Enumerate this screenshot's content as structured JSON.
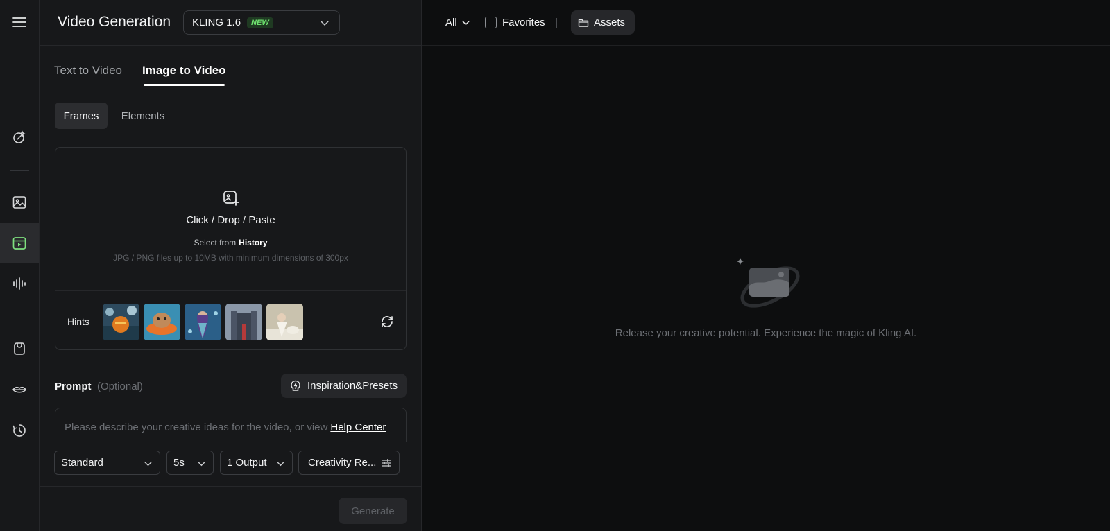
{
  "header": {
    "title": "Video Generation",
    "model": "KLING 1.6",
    "model_badge": "NEW"
  },
  "tabs": [
    {
      "label": "Text to Video"
    },
    {
      "label": "Image to Video",
      "active": true
    }
  ],
  "subtabs": [
    {
      "label": "Frames",
      "active": true
    },
    {
      "label": "Elements"
    }
  ],
  "upload": {
    "title": "Click / Drop / Paste",
    "select_from": "Select from",
    "history": "History",
    "note": "JPG / PNG files up to 10MB with minimum dimensions of 300px"
  },
  "hints": {
    "label": "Hints",
    "thumbnails": [
      "pumpkin-house-thumb",
      "capybara-float-thumb",
      "mermaid-thumb",
      "castle-thumb",
      "snow-girl-thumb"
    ]
  },
  "prompt": {
    "label": "Prompt",
    "optional": "(Optional)",
    "placeholder": "Please describe your creative ideas for the video, or view",
    "help_link": "Help Center",
    "inspiration_button": "Inspiration&Presets"
  },
  "settings": {
    "mode": "Standard",
    "duration": "5s",
    "outputs": "1 Output",
    "creativity": "Creativity Re..."
  },
  "generate_button": "Generate",
  "topbar": {
    "filter": "All",
    "favorites": "Favorites",
    "assets": "Assets"
  },
  "empty_message": "Release your creative potential. Experience the magic of Kling AI.",
  "colors": {
    "background": "#0d0e0f",
    "panel": "#17181a",
    "accent_green": "#6fe36f",
    "active_icon": "#7ee07e"
  }
}
